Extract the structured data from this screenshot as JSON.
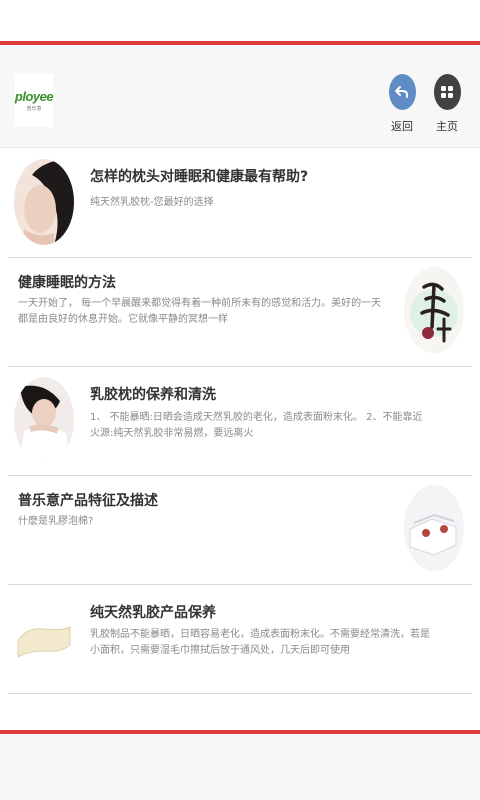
{
  "header": {
    "logo_text": "ployee",
    "logo_sub": "普乐意",
    "back_label": "返回",
    "home_label": "主页"
  },
  "items": [
    {
      "title": "怎样的枕头对睡眠和健康最有帮助?",
      "desc": "纯天然乳胶枕-您最好的选择"
    },
    {
      "title": "健康睡眠的方法",
      "desc": "一天开始了， 每一个早晨醒来都觉得有着一种前所未有的感觉和活力。美好的一天都是由良好的休息开始。它就像平静的冥想一样"
    },
    {
      "title": "乳胶枕的保养和清洗",
      "desc": "1、 不能暴晒:日晒会造成天然乳胶的老化，造成表面粉末化。 2、不能靠近火源:纯天然乳胶非常易燃，要远离火"
    },
    {
      "title": "普乐意产品特征及描述",
      "desc": "什麽是乳膠泡棉?"
    },
    {
      "title": "纯天然乳胶产品保养",
      "desc": "乳胶制品不能暴晒，日晒容易老化，造成表面粉末化。不需要经常清洗，若是小面积，只需要湿毛巾擦拭后放于通风处，几天后即可使用"
    }
  ]
}
